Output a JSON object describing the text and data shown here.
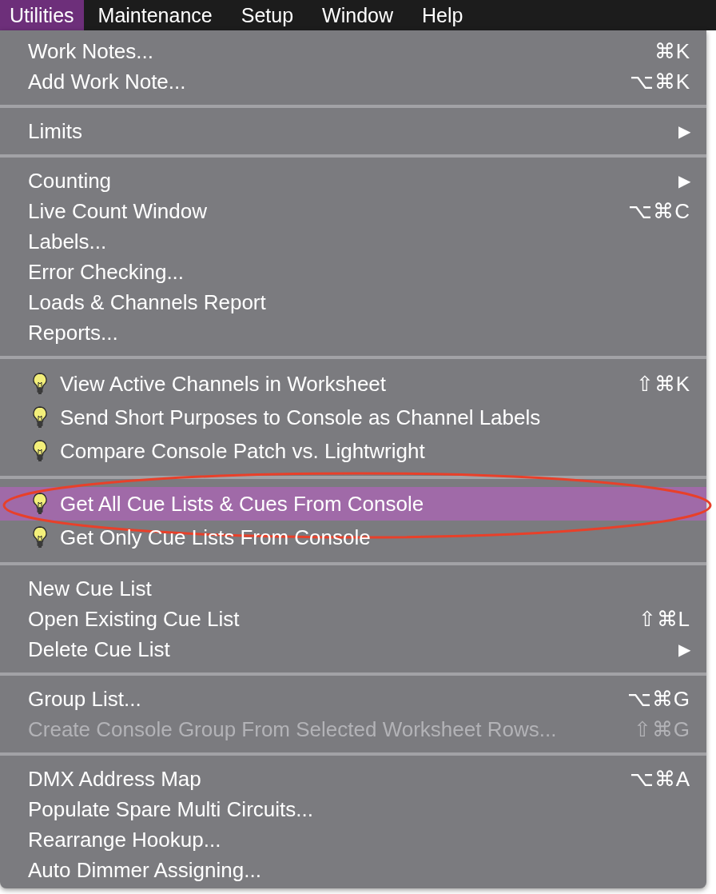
{
  "menubar": [
    {
      "label": "Utilities",
      "selected": true
    },
    {
      "label": "Maintenance",
      "selected": false
    },
    {
      "label": "Setup",
      "selected": false
    },
    {
      "label": "Window",
      "selected": false
    },
    {
      "label": "Help",
      "selected": false
    }
  ],
  "menu": {
    "sections": [
      [
        {
          "label": "Work Notes...",
          "shortcut": "⌘K",
          "selected": false,
          "disabled": false
        },
        {
          "label": "Add Work Note...",
          "shortcut": "⌥⌘K",
          "selected": false,
          "disabled": false
        }
      ],
      [
        {
          "label": "Limits",
          "submenu_arrow": "▶",
          "selected": false,
          "disabled": false
        }
      ],
      [
        {
          "label": "Counting",
          "submenu_arrow": "▶",
          "selected": false,
          "disabled": false
        },
        {
          "label": "Live Count Window",
          "shortcut": "⌥⌘C",
          "selected": false,
          "disabled": false
        },
        {
          "label": "Labels...",
          "selected": false,
          "disabled": false
        },
        {
          "label": "Error Checking...",
          "selected": false,
          "disabled": false
        },
        {
          "label": "Loads & Channels Report",
          "selected": false,
          "disabled": false
        },
        {
          "label": "Reports...",
          "selected": false,
          "disabled": false
        }
      ],
      [
        {
          "label": "View Active Channels in Worksheet",
          "shortcut": "⇧⌘K",
          "kind": "bulb",
          "selected": false,
          "disabled": false
        },
        {
          "label": "Send Short Purposes to Console as Channel Labels",
          "kind": "bulb",
          "selected": false,
          "disabled": false
        },
        {
          "label": "Compare Console Patch vs. Lightwright",
          "kind": "bulb",
          "selected": false,
          "disabled": false
        }
      ],
      [
        {
          "label": "Get All Cue Lists & Cues From Console",
          "kind": "bulb",
          "selected": true,
          "disabled": false,
          "annotated": true
        },
        {
          "label": "Get Only Cue Lists From Console",
          "kind": "bulb",
          "selected": false,
          "disabled": false,
          "annotated": false
        }
      ],
      [
        {
          "label": "New Cue List",
          "selected": false,
          "disabled": false
        },
        {
          "label": "Open Existing Cue List",
          "shortcut": "⇧⌘L",
          "selected": false,
          "disabled": false
        },
        {
          "label": "Delete Cue List",
          "submenu_arrow": "▶",
          "selected": false,
          "disabled": false
        }
      ],
      [
        {
          "label": "Group List...",
          "shortcut": "⌥⌘G",
          "selected": false,
          "disabled": false
        },
        {
          "label": "Create Console Group From Selected Worksheet Rows...",
          "shortcut": "⇧⌘G",
          "selected": false,
          "disabled": true
        }
      ],
      [
        {
          "label": "DMX Address Map",
          "shortcut": "⌥⌘A",
          "selected": false,
          "disabled": false
        },
        {
          "label": "Populate Spare Multi Circuits...",
          "selected": false,
          "disabled": false
        },
        {
          "label": "Rearrange Hookup...",
          "selected": false,
          "disabled": false
        },
        {
          "label": "Auto Dimmer Assigning...",
          "selected": false,
          "disabled": false
        }
      ]
    ]
  }
}
